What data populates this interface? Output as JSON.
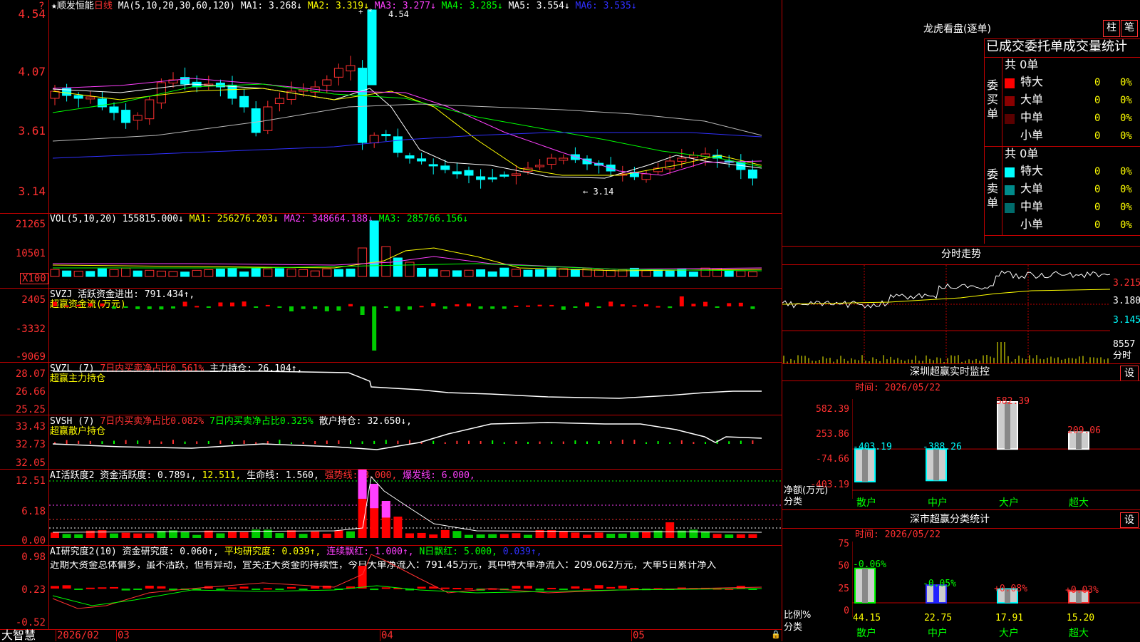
{
  "main": {
    "stock_name": "顺发恒能",
    "period": "日线",
    "ma_title": "MA(5,10,20,30,60,120)",
    "ma1": "MA1: 3.268↓",
    "ma2": "MA2: 3.319↓",
    "ma3": "MA3: 3.277↓",
    "ma4": "MA4: 3.285↓",
    "ma5": "MA5: 3.554↓",
    "ma6": "MA6: 3.535↓",
    "y_labels": [
      "4.54",
      "4.07",
      "3.61",
      "3.14"
    ],
    "high_mark": "4.54",
    "low_mark": "← 3.14"
  },
  "vol": {
    "title": "VOL(5,10,20)",
    "value": "155815.000↓",
    "ma1": "MA1: 256276.203↓",
    "ma2": "MA2: 348664.188↓",
    "ma3": "MA3: 285766.156↓",
    "y_labels": [
      "21265",
      "10501"
    ],
    "unit": "X100"
  },
  "svzj": {
    "title": "SVZJ",
    "text": "活跃资金进出: 791.434↑,",
    "sub": "超赢资金流(万元)",
    "y_labels": [
      "2405",
      "-3332",
      "-9069"
    ]
  },
  "svzl": {
    "title": "SVZL (7)",
    "ratio": "7日内买卖净占比0.561%",
    "hold": "主力持仓: 26.104↑,",
    "sub": "超赢主力持仓",
    "y_labels": [
      "28.07",
      "26.66",
      "25.25"
    ]
  },
  "svsh": {
    "title": "SVSH (7)",
    "ratio1": "7日内买卖净占比0.082%",
    "ratio2": "7日内买卖净占比0.325%",
    "hold": "散户持仓: 32.650↓,",
    "sub": "超赢散户持仓",
    "y_labels": [
      "33.43",
      "32.73",
      "32.05"
    ]
  },
  "ai1": {
    "title": "AI活跃度2",
    "a": "资金活跃度: 0.789↓,",
    "b": "12.511,",
    "c": "生命线: 1.560,",
    "d": "强势线: 3.000,",
    "e": "爆发线: 6.000,",
    "y_labels": [
      "12.51",
      "6.18",
      "0.00"
    ]
  },
  "ai2": {
    "title": "AI研究度2(10)",
    "a": "资金研究度: 0.060↑,",
    "b": "平均研究度: 0.039↑,",
    "c": "连续飘红: 1.000↑,",
    "d": "N日飘红: 5.000,",
    "e": "0.039↑,",
    "comment": "近期大资金总体偏多，虽不活跃，但有异动，宜关注大资金的持续性，今日大单净流入：791.45万元，其中特大单净流入：209.062万元，大单5日累计净入",
    "y_labels": [
      "0.98",
      "0.23",
      "-0.52"
    ]
  },
  "timeline": {
    "brand": "大智慧",
    "labels": [
      "2026/02",
      "03",
      "04",
      "05"
    ]
  },
  "dragon": {
    "title": "龙虎看盘(逐单)",
    "btn1": "柱",
    "btn2": "笔",
    "subtitle": "已成交委托单成交量统计",
    "buy_label": "委买单",
    "sell_label": "委卖单",
    "buy_total": "共 0单",
    "sell_total": "共 0单",
    "buy_rows": [
      {
        "name": "特大",
        "count": "0",
        "pct": "0%",
        "color": "#ff0000"
      },
      {
        "name": "大单",
        "count": "0",
        "pct": "0%",
        "color": "#8b0000"
      },
      {
        "name": "中单",
        "count": "0",
        "pct": "0%",
        "color": "#5a0000"
      },
      {
        "name": "小单",
        "count": "0",
        "pct": "0%",
        "color": "#000000"
      }
    ],
    "sell_rows": [
      {
        "name": "特大",
        "count": "0",
        "pct": "0%",
        "color": "#00ffff"
      },
      {
        "name": "大单",
        "count": "0",
        "pct": "0%",
        "color": "#008b8b"
      },
      {
        "name": "中单",
        "count": "0",
        "pct": "0%",
        "color": "#006b6b"
      },
      {
        "name": "小单",
        "count": "0",
        "pct": "0%",
        "color": "#000000"
      }
    ]
  },
  "minute": {
    "title": "分时走势",
    "prices": [
      "3.215",
      "3.180",
      "3.145"
    ],
    "vol": "8557",
    "vol_unit": "分时"
  },
  "sz_monitor": {
    "title": "深圳超赢实时监控",
    "btn": "设",
    "time": "时间: 2026/05/22",
    "y_labels": [
      "582.39",
      "253.86",
      "-74.66",
      "-403.19"
    ],
    "axis_label1": "净额(万元)",
    "axis_label2": "分类",
    "categories": [
      "散户",
      "中户",
      "大户",
      "超大"
    ],
    "values": [
      -403.19,
      -388.26,
      582.39,
      209.06
    ],
    "value_labels": [
      "-403.19",
      "-388.26",
      "582.39",
      "209.06"
    ]
  },
  "sz_class": {
    "title": "深市超赢分类统计",
    "btn": "设",
    "time": "时间: 2026/05/22",
    "y_labels": [
      "75",
      "50",
      "25",
      "0"
    ],
    "axis_label1": "比例%",
    "axis_label2": "分类",
    "categories": [
      "散户",
      "中户",
      "大户",
      "超大"
    ],
    "values": [
      44.15,
      22.75,
      17.91,
      15.2
    ],
    "value_labels": [
      "44.15",
      "22.75",
      "17.91",
      "15.20"
    ],
    "change_labels": [
      "-0.06%",
      "-0.05%",
      "+0.08%",
      "+0.03%"
    ]
  },
  "colors": {
    "up": "#ff3030",
    "down": "#00ffff",
    "grid": "#c00000"
  }
}
